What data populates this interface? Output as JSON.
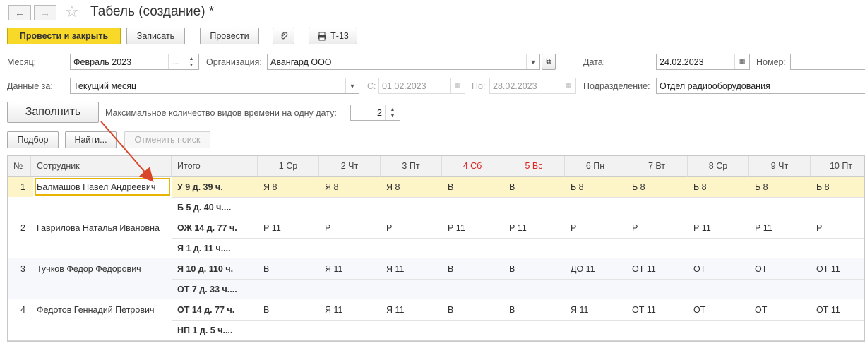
{
  "window": {
    "title": "Табель (создание) *"
  },
  "toolbar": {
    "post_close": "Провести и закрыть",
    "save": "Записать",
    "post": "Провести",
    "print_t13": "Т-13"
  },
  "form": {
    "month_label": "Месяц:",
    "month_value": "Февраль 2023",
    "org_label": "Организация:",
    "org_value": "Авангард ООО",
    "date_label": "Дата:",
    "date_value": "24.02.2023",
    "number_label": "Номер:",
    "number_value": "",
    "data_for_label": "Данные за:",
    "data_for_value": "Текущий месяц",
    "from_label": "С:",
    "from_value": "01.02.2023",
    "to_label": "По:",
    "to_value": "28.02.2023",
    "dept_label": "Подразделение:",
    "dept_value": "Отдел радиооборудования",
    "fill_button": "Заполнить",
    "max_types_label": "Максимальное количество видов времени на одну дату:",
    "max_types_value": "2"
  },
  "table_toolbar": {
    "select": "Подбор",
    "find": "Найти...",
    "cancel_search": "Отменить поиск"
  },
  "table": {
    "columns": {
      "num": "№",
      "employee": "Сотрудник",
      "total": "Итого",
      "days": [
        "1 Ср",
        "2 Чт",
        "3 Пт",
        "4 Сб",
        "5 Вс",
        "6 Пн",
        "7 Вт",
        "8 Ср",
        "9 Чт",
        "10 Пт"
      ],
      "weekend_days": [
        3,
        4
      ]
    },
    "rows": [
      {
        "num": "1",
        "employee": "Балмашов Павел Андреевич",
        "total1": "У 9 д. 39 ч.",
        "total2": "Б 5 д. 40 ч....",
        "days1": [
          "Я 8",
          "Я 8",
          "Я 8",
          "В",
          "В",
          "Б 8",
          "Б 8",
          "Б 8",
          "Б 8",
          "Б 8"
        ],
        "days2": [
          "",
          "",
          "",
          "",
          "",
          "",
          "",
          "",
          "",
          ""
        ]
      },
      {
        "num": "2",
        "employee": "Гаврилова Наталья Ивановна",
        "total1": "ОЖ 14 д. 77 ч.",
        "total2": "Я 1 д. 11 ч....",
        "days1": [
          "Р 11",
          "Р",
          "Р",
          "Р 11",
          "Р 11",
          "Р",
          "Р",
          "Р 11",
          "Р 11",
          "Р"
        ],
        "days2": [
          "",
          "",
          "",
          "",
          "",
          "",
          "",
          "",
          "",
          ""
        ]
      },
      {
        "num": "3",
        "employee": "Тучков Федор Федорович",
        "total1": "Я 10 д. 110 ч.",
        "total2": "ОТ 7 д. 33 ч....",
        "days1": [
          "В",
          "Я 11",
          "Я 11",
          "В",
          "В",
          "ДО 11",
          "ОТ 11",
          "ОТ",
          "ОТ",
          "ОТ 11"
        ],
        "days2": [
          "",
          "",
          "",
          "",
          "",
          "",
          "",
          "",
          "",
          ""
        ]
      },
      {
        "num": "4",
        "employee": "Федотов Геннадий Петрович",
        "total1": "ОТ 14 д. 77 ч.",
        "total2": "НП 1 д. 5 ч....",
        "days1": [
          "В",
          "Я 11",
          "Я 11",
          "В",
          "В",
          "Я 11",
          "ОТ 11",
          "ОТ",
          "ОТ",
          "ОТ 11"
        ],
        "days2": [
          "",
          "",
          "",
          "",
          "",
          "",
          "",
          "",
          "",
          ""
        ]
      }
    ]
  },
  "colors": {
    "primary_button": "#f8d92a",
    "selected_row": "#fdf4c8",
    "weekend_header": "#dd2222",
    "arrow": "#d9472b"
  }
}
